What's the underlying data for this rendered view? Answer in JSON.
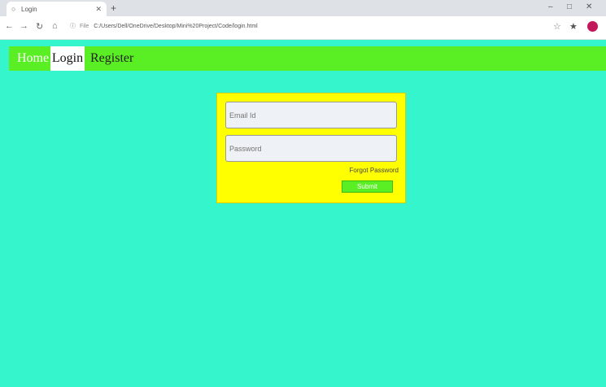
{
  "browser": {
    "tab_title": "Login",
    "new_tab_label": "+",
    "window_controls": [
      "–",
      "□",
      "✕"
    ],
    "address_scheme": "File",
    "address": "C:/Users/Dell/OneDrive/Desktop/Mini%20Project/Code/login.html"
  },
  "nav": {
    "links": [
      "Home",
      "Login",
      "Register"
    ],
    "active": "Login"
  },
  "form": {
    "email_placeholder": "Email Id",
    "password_placeholder": "Password",
    "forgot_label": "Forgot Password",
    "submit_label": "Submit"
  },
  "colors": {
    "page_background": "#34f5cb",
    "navbar": "#5aee24",
    "form_background": "#ffff00",
    "submit_button": "#5aee24"
  }
}
